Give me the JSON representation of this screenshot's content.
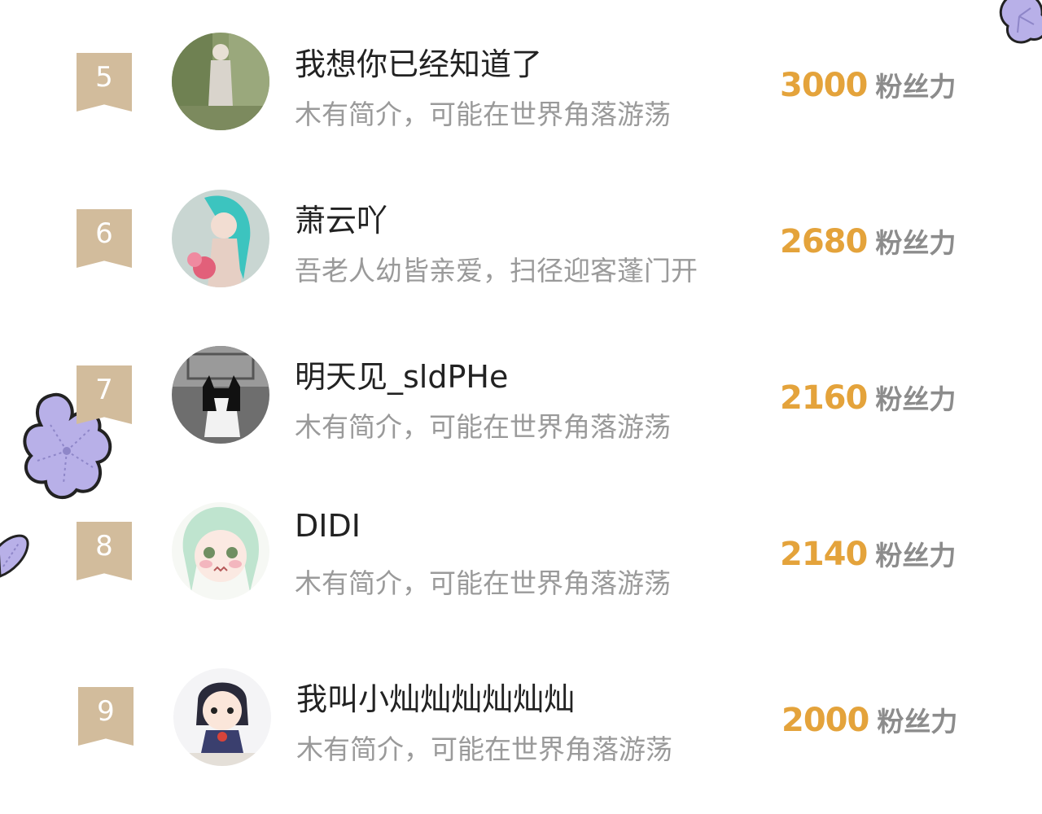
{
  "ranking_list": {
    "items": [
      {
        "rank": "5",
        "name": "我想你已经知道了",
        "bio": "木有简介，可能在世界角落游荡",
        "score": "3000",
        "score_unit": "粉丝力",
        "avatar": "forest-girl-avatar"
      },
      {
        "rank": "6",
        "name": "萧云吖",
        "bio": "吾老人幼皆亲爱，扫径迎客蓬门开",
        "score": "2680",
        "score_unit": "粉丝力",
        "avatar": "teal-hair-girl-avatar"
      },
      {
        "rank": "7",
        "name": "明天见_sldPHe",
        "bio": "木有简介，可能在世界角落游荡",
        "score": "2160",
        "score_unit": "粉丝力",
        "avatar": "black-white-cat-avatar"
      },
      {
        "rank": "8",
        "name": "DIDI",
        "bio": "木有简介，可能在世界角落游荡",
        "score": "2140",
        "score_unit": "粉丝力",
        "avatar": "anime-green-hair-avatar"
      },
      {
        "rank": "9",
        "name": "我叫小灿灿灿灿灿灿",
        "bio": "木有简介，可能在世界角落游荡",
        "score": "2000",
        "score_unit": "粉丝力",
        "avatar": "doll-figure-avatar"
      }
    ]
  },
  "colors": {
    "rank_badge": "#d2bc9c",
    "score": "#e4a33b",
    "name": "#222222",
    "bio": "#9a9a9a",
    "decoration_flower": "#b8b0e8"
  }
}
